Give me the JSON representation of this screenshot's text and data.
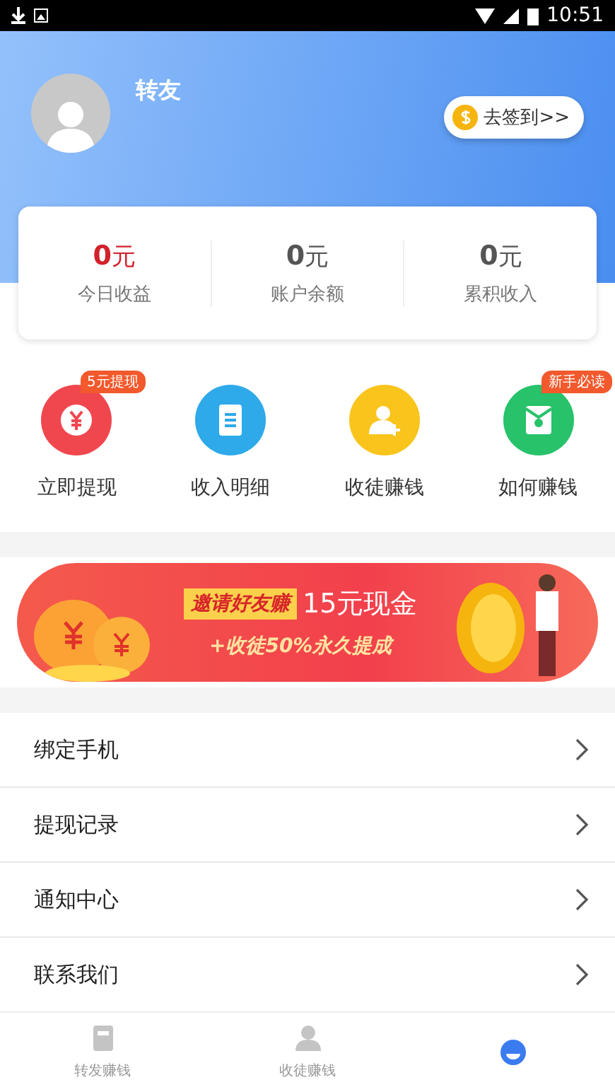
{
  "status_bar": {
    "time": "10:51"
  },
  "profile": {
    "name": "转友",
    "checkin_button": "去签到>>"
  },
  "stats": [
    {
      "value": "0",
      "unit": "元",
      "label": "今日收益",
      "kind": "highlight"
    },
    {
      "value": "0",
      "unit": "元",
      "label": "账户余额",
      "kind": "normal"
    },
    {
      "value": "0",
      "unit": "元",
      "label": "累积收入",
      "kind": "normal"
    }
  ],
  "shortcuts": [
    {
      "label": "立即提现",
      "badge": "5元提现",
      "kind": "withdraw",
      "color": "#f0474f"
    },
    {
      "label": "收入明细",
      "kind": "detail",
      "color": "#2ea9ea"
    },
    {
      "label": "收徒赚钱",
      "kind": "recruit",
      "color": "#f9c41c"
    },
    {
      "label": "如何赚钱",
      "badge": "新手必读",
      "kind": "guide",
      "color": "#27c26a"
    }
  ],
  "banner": {
    "tag": "邀请好友赚",
    "amount": "15元现金",
    "subtitle": "+收徒50%永久提成"
  },
  "menu": [
    {
      "label": "绑定手机"
    },
    {
      "label": "提现记录"
    },
    {
      "label": "通知中心"
    },
    {
      "label": "联系我们"
    }
  ],
  "tabs": [
    {
      "label": "转发赚钱",
      "kind": "share",
      "selected": false
    },
    {
      "label": "收徒赚钱",
      "kind": "recruit",
      "selected": false
    },
    {
      "kind": "profile",
      "selected": true
    }
  ]
}
